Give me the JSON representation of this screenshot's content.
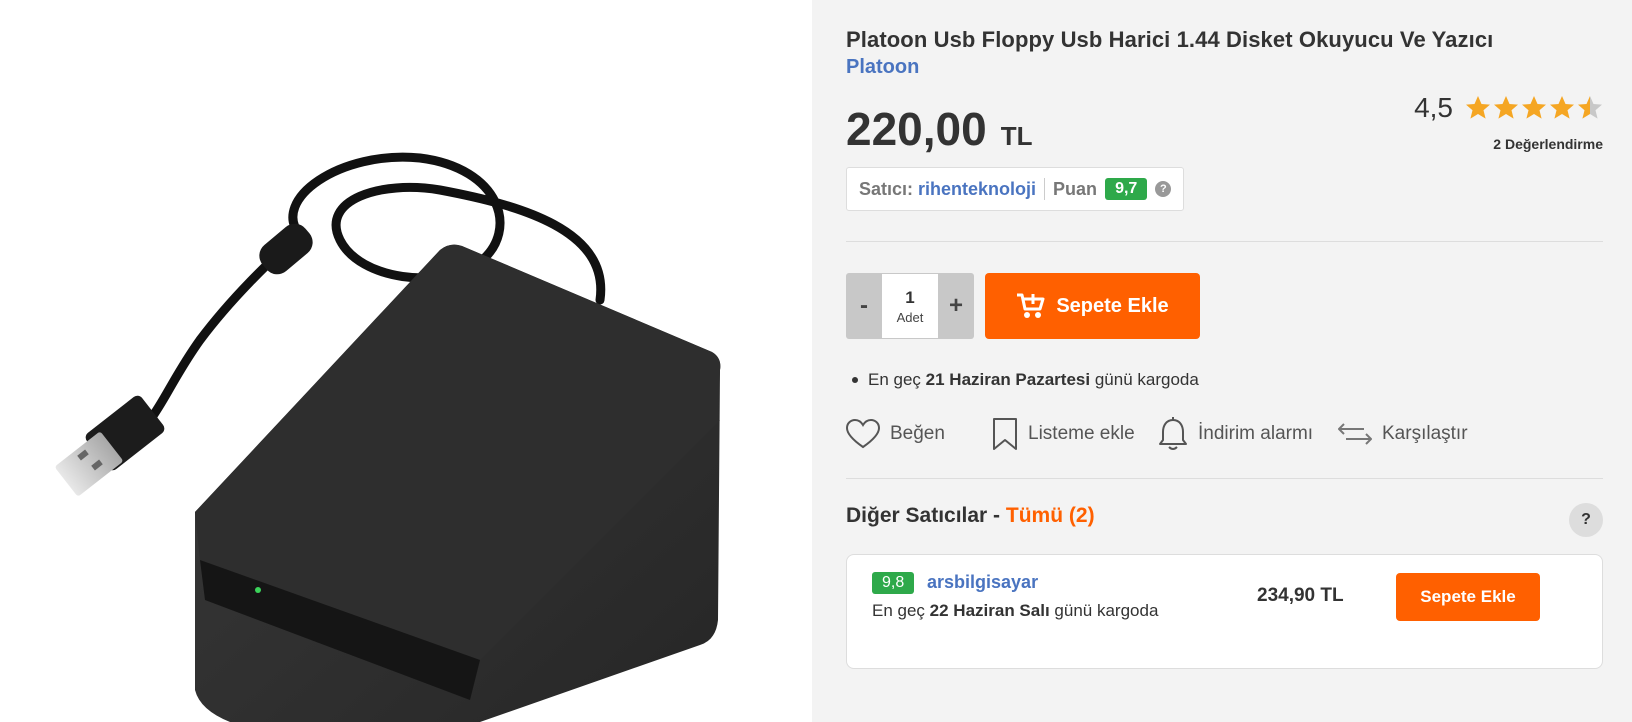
{
  "product": {
    "title": "Platoon Usb Floppy Usb Harici 1.44 Disket Okuyucu Ve Yazıcı",
    "brand": "Platoon",
    "image_icon": "floppy-drive-image",
    "price_value": "220,00",
    "price_currency": "TL"
  },
  "rating": {
    "value": "4,5",
    "stars": 4.5,
    "count_label": "2 Değerlendirme",
    "star_color": "#f5a623"
  },
  "seller": {
    "label": "Satıcı:",
    "name": "rihenteknoloji",
    "score_label": "Puan",
    "score": "9,7",
    "help": "?"
  },
  "quantity": {
    "minus": "-",
    "plus": "+",
    "value": "1",
    "unit": "Adet"
  },
  "cart": {
    "label": "Sepete Ekle",
    "icon": "cart-icon",
    "color": "#ff6000"
  },
  "delivery": {
    "prefix": "En geç",
    "date": "21 Haziran Pazartesi",
    "suffix": "günü kargoda"
  },
  "actions": {
    "like": "Beğen",
    "list": "Listeme ekle",
    "alarm": "İndirim alarmı",
    "compare": "Karşılaştır"
  },
  "other_sellers": {
    "title": "Diğer Satıcılar -",
    "all_link": "Tümü (2)",
    "help": "?",
    "items": [
      {
        "score": "9,8",
        "name": "arsbilgisayar",
        "delivery_prefix": "En geç",
        "delivery_date": "22 Haziran Salı",
        "delivery_suffix": "günü kargoda",
        "price": "234,90 TL",
        "button": "Sepete Ekle"
      }
    ]
  }
}
